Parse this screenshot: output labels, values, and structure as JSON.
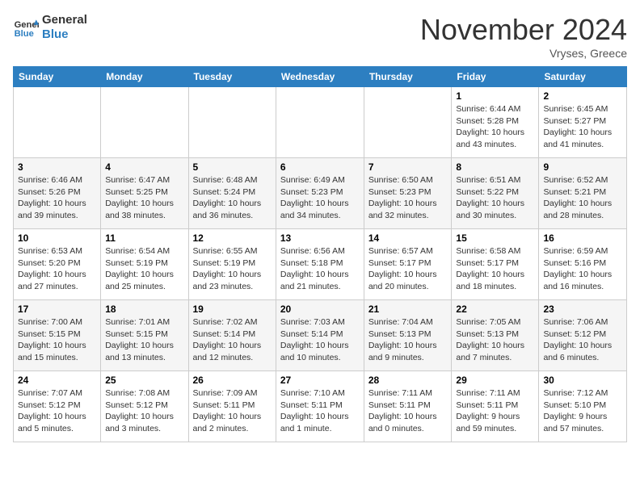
{
  "header": {
    "logo_line1": "General",
    "logo_line2": "Blue",
    "month": "November 2024",
    "location": "Vryses, Greece"
  },
  "days_of_week": [
    "Sunday",
    "Monday",
    "Tuesday",
    "Wednesday",
    "Thursday",
    "Friday",
    "Saturday"
  ],
  "weeks": [
    [
      {
        "day": "",
        "info": ""
      },
      {
        "day": "",
        "info": ""
      },
      {
        "day": "",
        "info": ""
      },
      {
        "day": "",
        "info": ""
      },
      {
        "day": "",
        "info": ""
      },
      {
        "day": "1",
        "info": "Sunrise: 6:44 AM\nSunset: 5:28 PM\nDaylight: 10 hours\nand 43 minutes."
      },
      {
        "day": "2",
        "info": "Sunrise: 6:45 AM\nSunset: 5:27 PM\nDaylight: 10 hours\nand 41 minutes."
      }
    ],
    [
      {
        "day": "3",
        "info": "Sunrise: 6:46 AM\nSunset: 5:26 PM\nDaylight: 10 hours\nand 39 minutes."
      },
      {
        "day": "4",
        "info": "Sunrise: 6:47 AM\nSunset: 5:25 PM\nDaylight: 10 hours\nand 38 minutes."
      },
      {
        "day": "5",
        "info": "Sunrise: 6:48 AM\nSunset: 5:24 PM\nDaylight: 10 hours\nand 36 minutes."
      },
      {
        "day": "6",
        "info": "Sunrise: 6:49 AM\nSunset: 5:23 PM\nDaylight: 10 hours\nand 34 minutes."
      },
      {
        "day": "7",
        "info": "Sunrise: 6:50 AM\nSunset: 5:23 PM\nDaylight: 10 hours\nand 32 minutes."
      },
      {
        "day": "8",
        "info": "Sunrise: 6:51 AM\nSunset: 5:22 PM\nDaylight: 10 hours\nand 30 minutes."
      },
      {
        "day": "9",
        "info": "Sunrise: 6:52 AM\nSunset: 5:21 PM\nDaylight: 10 hours\nand 28 minutes."
      }
    ],
    [
      {
        "day": "10",
        "info": "Sunrise: 6:53 AM\nSunset: 5:20 PM\nDaylight: 10 hours\nand 27 minutes."
      },
      {
        "day": "11",
        "info": "Sunrise: 6:54 AM\nSunset: 5:19 PM\nDaylight: 10 hours\nand 25 minutes."
      },
      {
        "day": "12",
        "info": "Sunrise: 6:55 AM\nSunset: 5:19 PM\nDaylight: 10 hours\nand 23 minutes."
      },
      {
        "day": "13",
        "info": "Sunrise: 6:56 AM\nSunset: 5:18 PM\nDaylight: 10 hours\nand 21 minutes."
      },
      {
        "day": "14",
        "info": "Sunrise: 6:57 AM\nSunset: 5:17 PM\nDaylight: 10 hours\nand 20 minutes."
      },
      {
        "day": "15",
        "info": "Sunrise: 6:58 AM\nSunset: 5:17 PM\nDaylight: 10 hours\nand 18 minutes."
      },
      {
        "day": "16",
        "info": "Sunrise: 6:59 AM\nSunset: 5:16 PM\nDaylight: 10 hours\nand 16 minutes."
      }
    ],
    [
      {
        "day": "17",
        "info": "Sunrise: 7:00 AM\nSunset: 5:15 PM\nDaylight: 10 hours\nand 15 minutes."
      },
      {
        "day": "18",
        "info": "Sunrise: 7:01 AM\nSunset: 5:15 PM\nDaylight: 10 hours\nand 13 minutes."
      },
      {
        "day": "19",
        "info": "Sunrise: 7:02 AM\nSunset: 5:14 PM\nDaylight: 10 hours\nand 12 minutes."
      },
      {
        "day": "20",
        "info": "Sunrise: 7:03 AM\nSunset: 5:14 PM\nDaylight: 10 hours\nand 10 minutes."
      },
      {
        "day": "21",
        "info": "Sunrise: 7:04 AM\nSunset: 5:13 PM\nDaylight: 10 hours\nand 9 minutes."
      },
      {
        "day": "22",
        "info": "Sunrise: 7:05 AM\nSunset: 5:13 PM\nDaylight: 10 hours\nand 7 minutes."
      },
      {
        "day": "23",
        "info": "Sunrise: 7:06 AM\nSunset: 5:12 PM\nDaylight: 10 hours\nand 6 minutes."
      }
    ],
    [
      {
        "day": "24",
        "info": "Sunrise: 7:07 AM\nSunset: 5:12 PM\nDaylight: 10 hours\nand 5 minutes."
      },
      {
        "day": "25",
        "info": "Sunrise: 7:08 AM\nSunset: 5:12 PM\nDaylight: 10 hours\nand 3 minutes."
      },
      {
        "day": "26",
        "info": "Sunrise: 7:09 AM\nSunset: 5:11 PM\nDaylight: 10 hours\nand 2 minutes."
      },
      {
        "day": "27",
        "info": "Sunrise: 7:10 AM\nSunset: 5:11 PM\nDaylight: 10 hours\nand 1 minute."
      },
      {
        "day": "28",
        "info": "Sunrise: 7:11 AM\nSunset: 5:11 PM\nDaylight: 10 hours\nand 0 minutes."
      },
      {
        "day": "29",
        "info": "Sunrise: 7:11 AM\nSunset: 5:11 PM\nDaylight: 9 hours\nand 59 minutes."
      },
      {
        "day": "30",
        "info": "Sunrise: 7:12 AM\nSunset: 5:10 PM\nDaylight: 9 hours\nand 57 minutes."
      }
    ]
  ]
}
